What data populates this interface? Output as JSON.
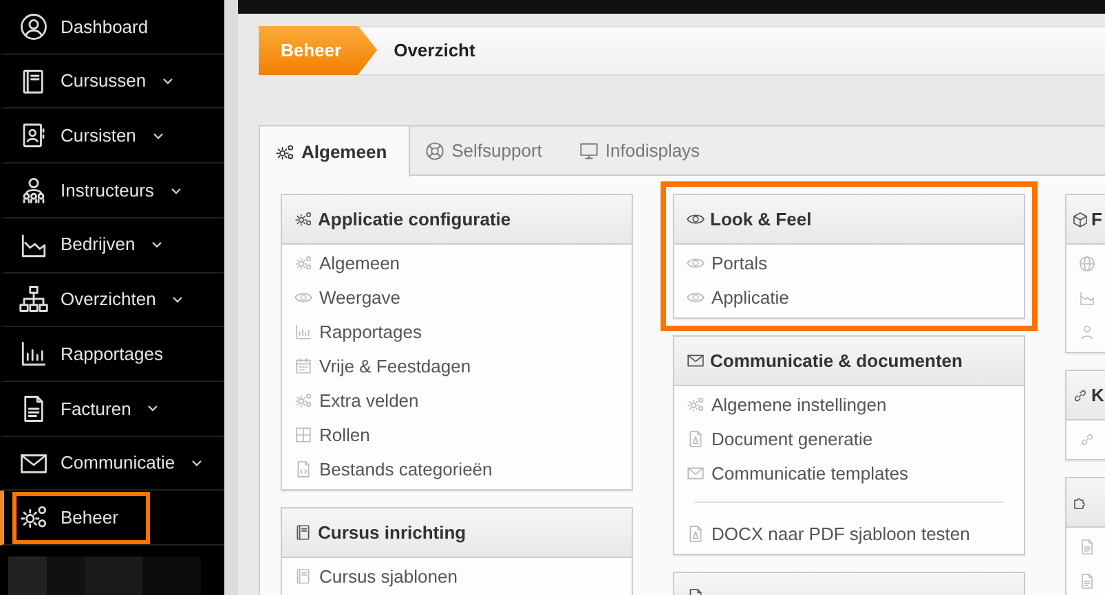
{
  "sidebar": {
    "items": [
      {
        "label": "Dashboard",
        "expandable": false,
        "selected": false,
        "highlighted": false
      },
      {
        "label": "Cursussen",
        "expandable": true,
        "selected": false,
        "highlighted": false
      },
      {
        "label": "Cursisten",
        "expandable": true,
        "selected": false,
        "highlighted": false
      },
      {
        "label": "Instructeurs",
        "expandable": true,
        "selected": false,
        "highlighted": false
      },
      {
        "label": "Bedrijven",
        "expandable": true,
        "selected": false,
        "highlighted": false
      },
      {
        "label": "Overzichten",
        "expandable": true,
        "selected": false,
        "highlighted": false
      },
      {
        "label": "Rapportages",
        "expandable": false,
        "selected": false,
        "highlighted": false
      },
      {
        "label": "Facturen",
        "expandable": true,
        "selected": false,
        "highlighted": false
      },
      {
        "label": "Communicatie",
        "expandable": true,
        "selected": false,
        "highlighted": false
      },
      {
        "label": "Beheer",
        "expandable": false,
        "selected": true,
        "highlighted": true
      }
    ]
  },
  "breadcrumb": [
    {
      "label": "Beheer",
      "kind": "section"
    },
    {
      "label": "Overzicht",
      "kind": "page"
    }
  ],
  "tabs": [
    {
      "label": "Algemeen",
      "selected": true
    },
    {
      "label": "Selfsupport",
      "selected": false
    },
    {
      "label": "Infodisplays",
      "selected": false
    }
  ],
  "columns": [
    [
      {
        "title": "Applicatie configuratie",
        "highlighted": false,
        "items": [
          {
            "kind": "link",
            "label": "Algemeen"
          },
          {
            "kind": "link",
            "label": "Weergave"
          },
          {
            "kind": "link",
            "label": "Rapportages"
          },
          {
            "kind": "link",
            "label": "Vrije & Feestdagen"
          },
          {
            "kind": "link",
            "label": "Extra velden"
          },
          {
            "kind": "link",
            "label": "Rollen"
          },
          {
            "kind": "link",
            "label": "Bestands categorieën"
          }
        ]
      },
      {
        "title": "Cursus inrichting",
        "highlighted": false,
        "items": [
          {
            "kind": "link",
            "label": "Cursus sjablonen"
          }
        ]
      }
    ],
    [
      {
        "title": "Look & Feel",
        "highlighted": true,
        "items": [
          {
            "kind": "link",
            "label": "Portals"
          },
          {
            "kind": "link",
            "label": "Applicatie"
          }
        ]
      },
      {
        "title": "Communicatie & documenten",
        "highlighted": false,
        "items": [
          {
            "kind": "link",
            "label": "Algemene instellingen"
          },
          {
            "kind": "link",
            "label": "Document generatie"
          },
          {
            "kind": "link",
            "label": "Communicatie templates"
          },
          {
            "kind": "divider"
          },
          {
            "kind": "link",
            "label": "DOCX naar PDF sjabloon testen"
          }
        ]
      },
      {
        "highlighted": false
      }
    ],
    [
      {
        "title": "F",
        "highlighted": false,
        "items": [
          {
            "kind": "icon-only"
          },
          {
            "kind": "icon-only"
          },
          {
            "kind": "icon-only"
          }
        ]
      },
      {
        "title": "K",
        "highlighted": false,
        "items": [
          {
            "kind": "icon-only"
          }
        ]
      },
      {
        "highlighted": false,
        "items": [
          {
            "kind": "icon-only"
          },
          {
            "kind": "icon-only"
          }
        ]
      }
    ]
  ]
}
